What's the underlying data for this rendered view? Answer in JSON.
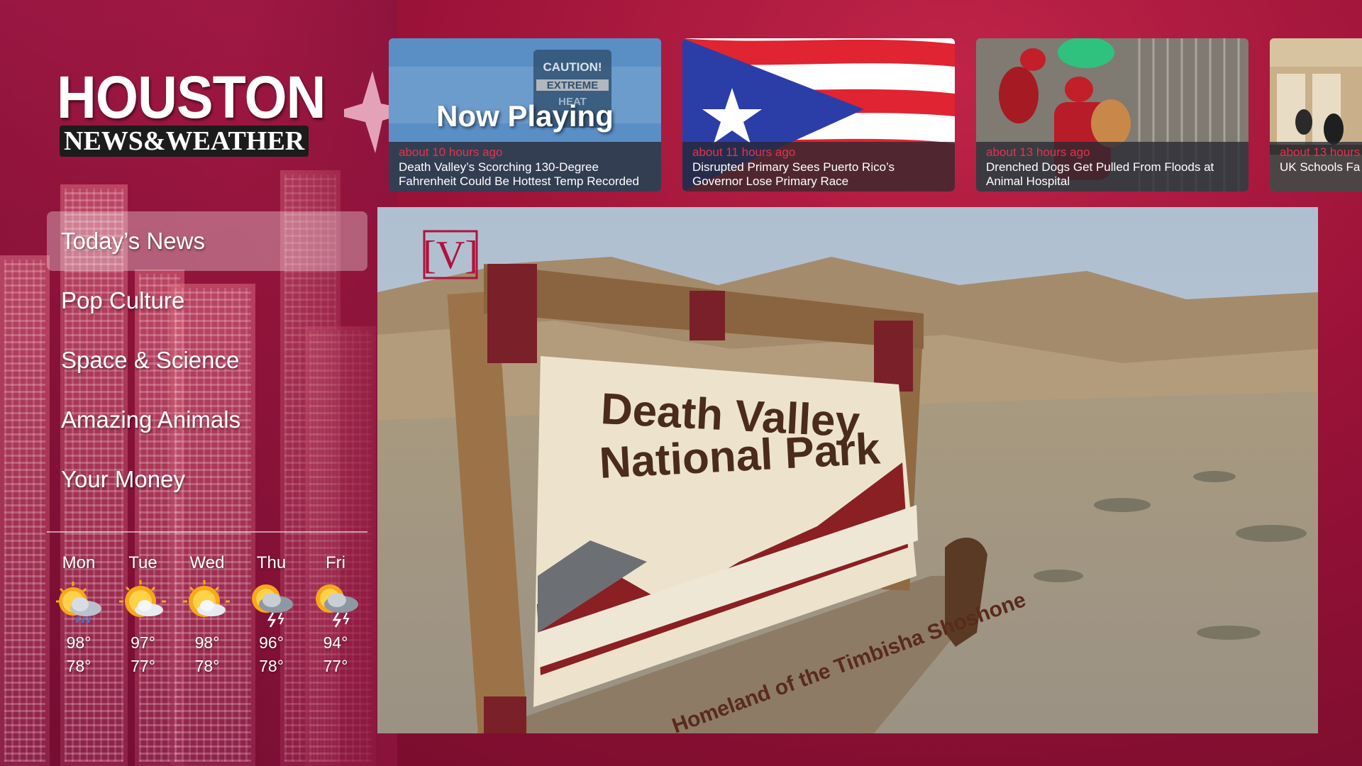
{
  "brand": {
    "line1": "HOUSTON",
    "line2": "NEWS&WEATHER",
    "accent_color": "#b0123e"
  },
  "nav": {
    "items": [
      {
        "label": "Today’s News",
        "active": true
      },
      {
        "label": "Pop Culture",
        "active": false
      },
      {
        "label": "Space & Science",
        "active": false
      },
      {
        "label": "Amazing Animals",
        "active": false
      },
      {
        "label": "Your Money",
        "active": false
      }
    ]
  },
  "weather": {
    "days": [
      {
        "day": "Mon",
        "high": "98°",
        "low": "78°",
        "icon": "sun-rain-cloud-icon"
      },
      {
        "day": "Tue",
        "high": "97°",
        "low": "77°",
        "icon": "sun-cloud-icon"
      },
      {
        "day": "Wed",
        "high": "98°",
        "low": "78°",
        "icon": "sun-cloud-icon"
      },
      {
        "day": "Thu",
        "high": "96°",
        "low": "78°",
        "icon": "sun-thunderstorm-icon"
      },
      {
        "day": "Fri",
        "high": "94°",
        "low": "77°",
        "icon": "sun-thunderstorm-icon"
      }
    ]
  },
  "carousel": {
    "now_playing_label": "Now Playing",
    "cards": [
      {
        "time": "about 10 hours ago",
        "title": "Death Valley’s Scorching 130-Degree Fahrenheit Could Be Hottest Temp Recorded",
        "sign_line1": "CAUTION!",
        "sign_line2": "EXTREME",
        "sign_line3": "HEAT"
      },
      {
        "time": "about 11 hours ago",
        "title": "Disrupted Primary Sees Puerto Rico’s Governor Lose Primary Race"
      },
      {
        "time": "about 13 hours ago",
        "title": "Drenched Dogs Get Pulled From Floods at Animal Hospital"
      },
      {
        "time": "about 13 hours",
        "title": "UK Schools Fa Algorithm Dete"
      }
    ]
  },
  "video": {
    "watermark": "[V]",
    "sign_line1": "Death Valley",
    "sign_line2": "National Park",
    "sign_base": "Homeland of the Timbisha Shoshone"
  }
}
